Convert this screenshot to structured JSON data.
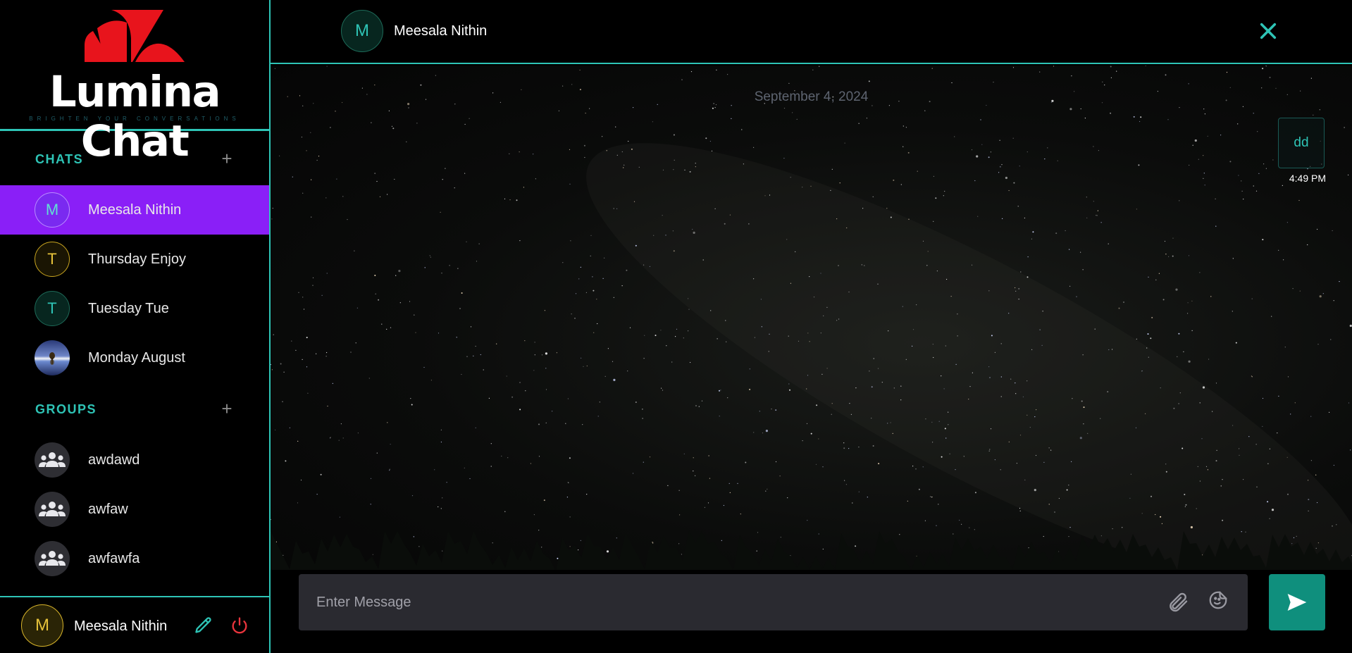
{
  "app": {
    "title": "Lumina Chat",
    "tagline": "BRIGHTEN YOUR CONVERSATIONS",
    "accent_color": "#2ec4b6",
    "active_color": "#8a1ff7",
    "logo_color": "#e8141c"
  },
  "sidebar": {
    "chats_label": "CHATS",
    "groups_label": "GROUPS",
    "add_icon": "+",
    "chats": [
      {
        "name": "Meesala Nithin",
        "initial": "M",
        "active": true,
        "ring": "#b98cff",
        "fg": "#5fe0d4",
        "bg": "#7a2af0"
      },
      {
        "name": "Thursday Enjoy",
        "initial": "T",
        "active": false,
        "ring": "#c9a51f",
        "fg": "#e6c23a",
        "bg": "#1a1503"
      },
      {
        "name": "Tuesday Tue",
        "initial": "T",
        "active": false,
        "ring": "#1d6a58",
        "fg": "#2ec4b6",
        "bg": "#07261f"
      },
      {
        "name": "Monday August",
        "initial": "",
        "active": false,
        "photo": true
      }
    ],
    "groups": [
      {
        "name": "awdawd",
        "icon": "group-icon"
      },
      {
        "name": "awfaw",
        "icon": "group-icon"
      },
      {
        "name": "awfawfa",
        "icon": "group-icon"
      }
    ]
  },
  "current_user": {
    "name": "Meesala Nithin",
    "initial": "M",
    "edit_icon": "pencil-icon",
    "logout_icon": "power-icon"
  },
  "conversation": {
    "name": "Meesala Nithin",
    "initial": "M",
    "close_icon": "close-icon",
    "date_divider": "September 4, 2024",
    "messages": [
      {
        "text": "dd",
        "time": "4:49 PM",
        "outgoing": true
      }
    ]
  },
  "composer": {
    "placeholder": "Enter Message",
    "attach_icon": "paperclip-icon",
    "sticker_icon": "sticker-icon",
    "send_icon": "send-icon"
  }
}
